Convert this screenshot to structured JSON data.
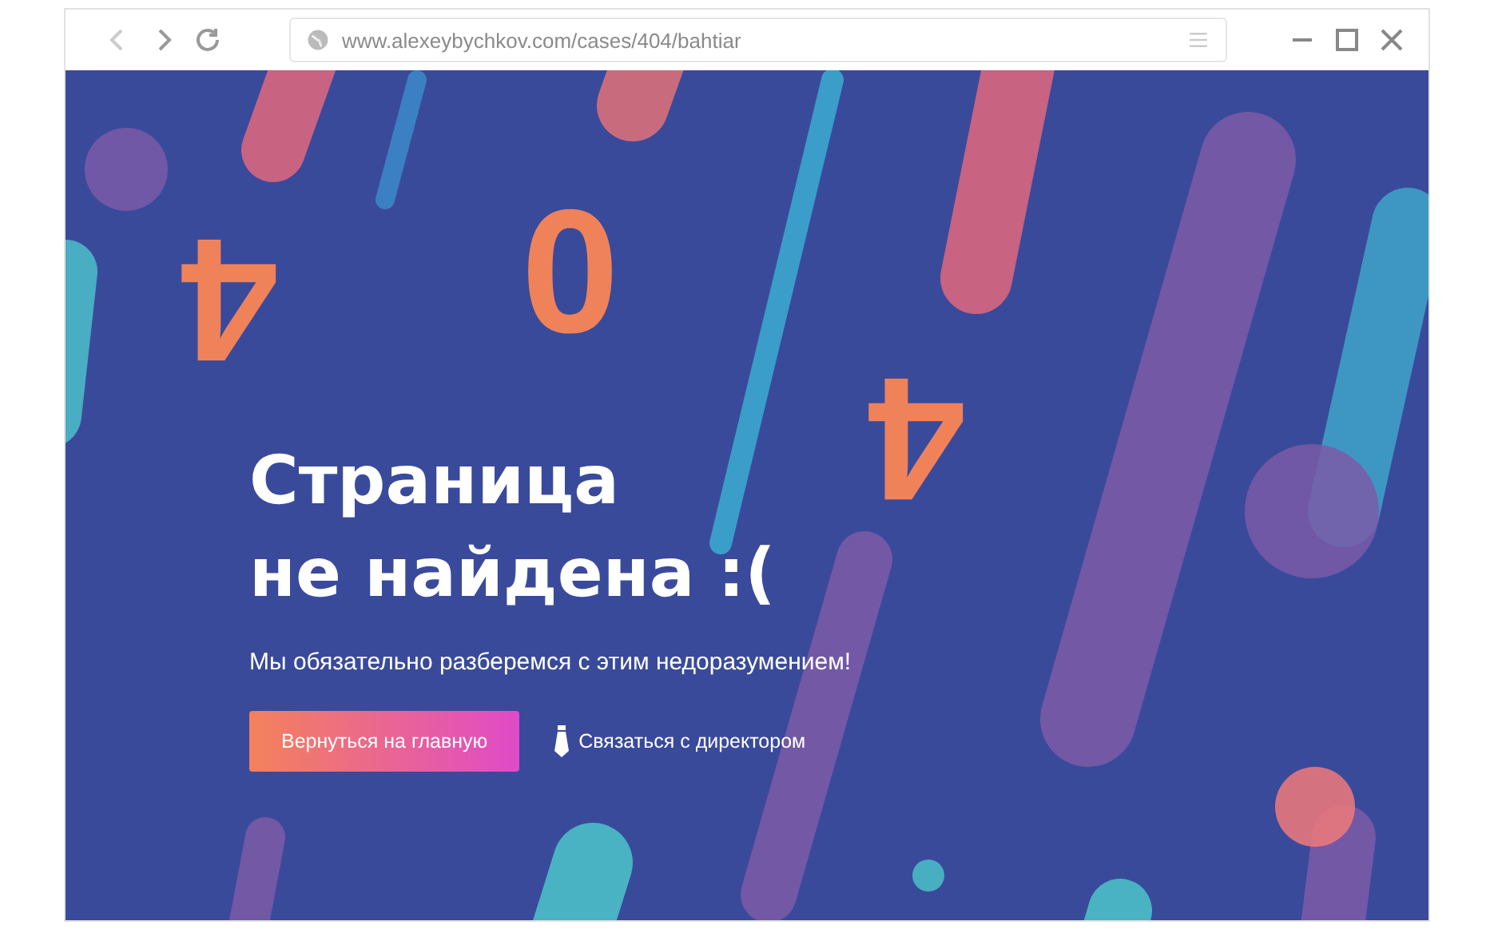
{
  "browser": {
    "url": "www.alexeybychkov.com/cases/404/bahtiar"
  },
  "digits": [
    "4",
    "0",
    "4"
  ],
  "title_lines": [
    "Страница",
    "не найдена :("
  ],
  "subtitle": "Мы обязательно разберемся с этим недоразумением!",
  "primary_button": "Вернуться на главную",
  "contact_link": "Связаться с директором"
}
